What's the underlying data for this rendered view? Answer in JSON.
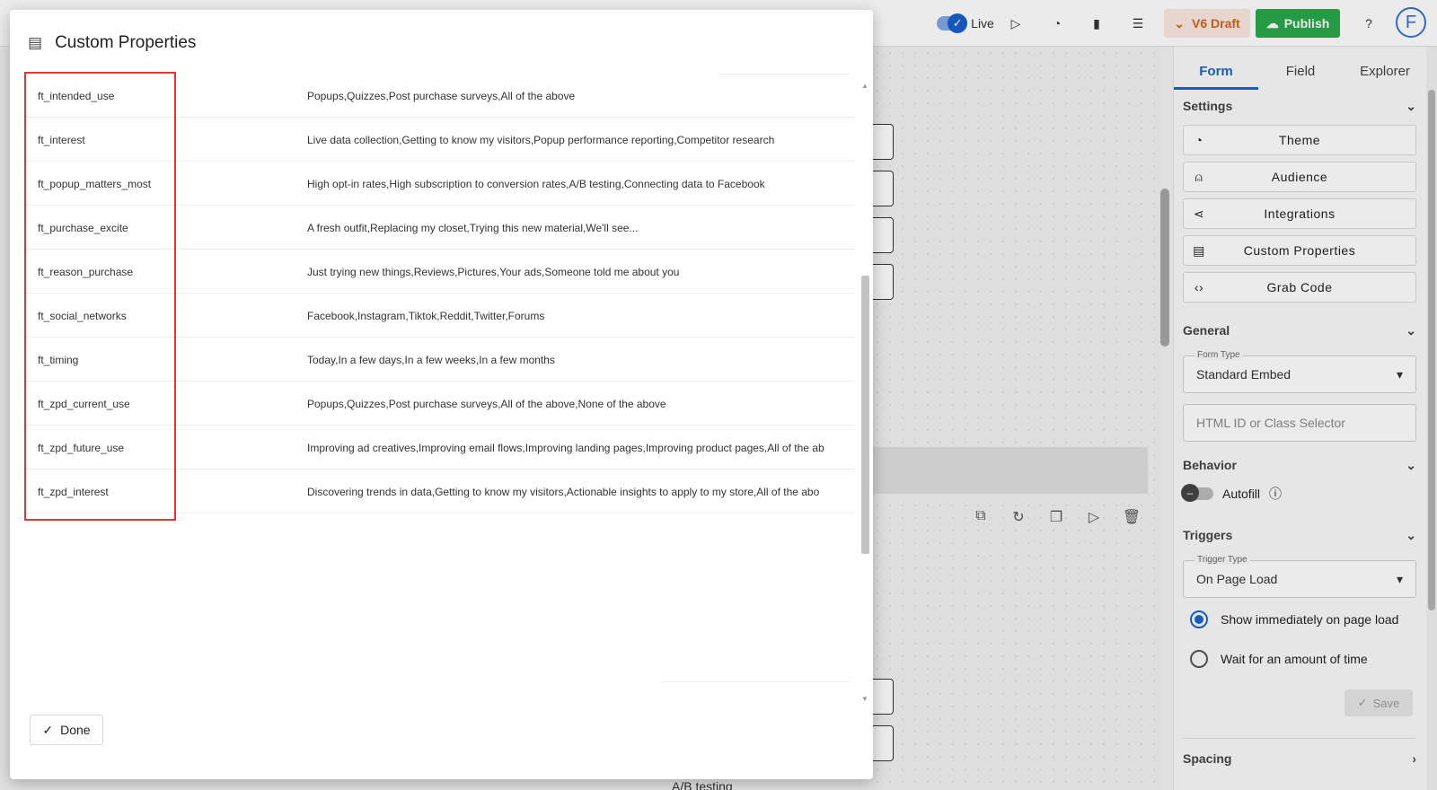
{
  "topbar": {
    "live_label": "Live",
    "draft_label": "V6 Draft",
    "publish_label": "Publish",
    "avatar_letter": "F"
  },
  "sidebar": {
    "tabs": [
      {
        "label": "Form",
        "active": true
      },
      {
        "label": "Field",
        "active": false
      },
      {
        "label": "Explorer",
        "active": false
      }
    ],
    "settings": {
      "title": "Settings",
      "buttons": [
        "Theme",
        "Audience",
        "Integrations",
        "Custom Properties",
        "Grab Code"
      ]
    },
    "general": {
      "title": "General",
      "form_type_label": "Form Type",
      "form_type_value": "Standard Embed",
      "selector_placeholder": "HTML ID or Class Selector"
    },
    "behavior": {
      "title": "Behavior",
      "autofill_label": "Autofill"
    },
    "triggers": {
      "title": "Triggers",
      "trigger_type_label": "Trigger Type",
      "trigger_type_value": "On Page Load",
      "option_immediate": "Show immediately on page load",
      "option_wait": "Wait for an amount of time",
      "save_label": "Save"
    },
    "spacing": {
      "title": "Spacing"
    }
  },
  "canvas": {
    "ab_text": "A/B testing"
  },
  "modal": {
    "title": "Custom Properties",
    "done_label": "Done",
    "rows": [
      {
        "key": "ft_intended_use",
        "value": "Popups,Quizzes,Post purchase surveys,All of the above"
      },
      {
        "key": "ft_interest",
        "value": "Live data collection,Getting to know my visitors,Popup performance reporting,Competitor research"
      },
      {
        "key": "ft_popup_matters_most",
        "value": "High opt-in rates,High subscription to conversion rates,A/B testing,Connecting data to Facebook"
      },
      {
        "key": "ft_purchase_excite",
        "value": "A fresh outfit,Replacing my closet,Trying this new material,We'll see..."
      },
      {
        "key": "ft_reason_purchase",
        "value": "Just trying new things,Reviews,Pictures,Your ads,Someone told me about you"
      },
      {
        "key": "ft_social_networks",
        "value": "Facebook,Instagram,Tiktok,Reddit,Twitter,Forums"
      },
      {
        "key": "ft_timing",
        "value": "Today,In a few days,In a few weeks,In a few months"
      },
      {
        "key": "ft_zpd_current_use",
        "value": "Popups,Quizzes,Post purchase surveys,All of the above,None of the above"
      },
      {
        "key": "ft_zpd_future_use",
        "value": "Improving ad creatives,Improving email flows,Improving landing pages,Improving product pages,All of the ab"
      },
      {
        "key": "ft_zpd_interest",
        "value": "Discovering trends in data,Getting to know my visitors,Actionable insights to apply to my store,All of the abo"
      }
    ]
  },
  "colors": {
    "accent": "#1a66c9",
    "publish": "#2aa84a",
    "draft": "#d4641c",
    "highlight": "#e23636"
  }
}
